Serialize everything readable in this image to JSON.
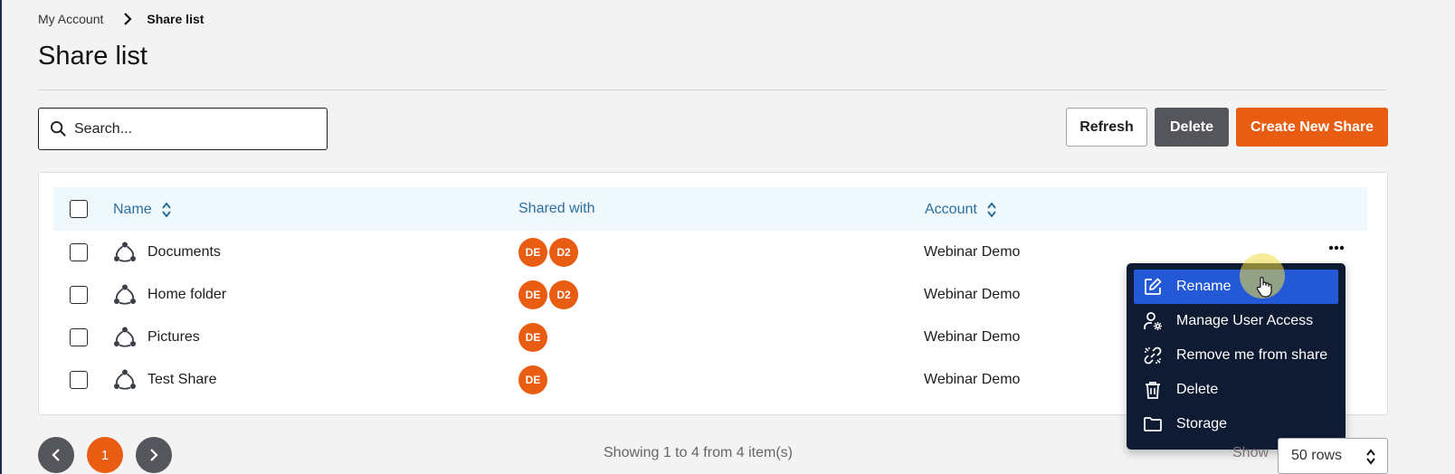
{
  "breadcrumb": {
    "parent": "My Account",
    "current": "Share list"
  },
  "page_title": "Share list",
  "search": {
    "placeholder": "Search...",
    "value": ""
  },
  "toolbar": {
    "refresh_label": "Refresh",
    "delete_label": "Delete",
    "create_label": "Create New Share"
  },
  "table": {
    "columns": {
      "name": "Name",
      "shared_with": "Shared with",
      "account": "Account"
    },
    "rows": [
      {
        "name": "Documents",
        "shared_with": [
          "DE",
          "D2"
        ],
        "account": "Webinar Demo"
      },
      {
        "name": "Home folder",
        "shared_with": [
          "DE",
          "D2"
        ],
        "account": "Webinar Demo"
      },
      {
        "name": "Pictures",
        "shared_with": [
          "DE"
        ],
        "account": "Webinar Demo"
      },
      {
        "name": "Test Share",
        "shared_with": [
          "DE"
        ],
        "account": "Webinar Demo"
      }
    ]
  },
  "context_menu": {
    "items": [
      {
        "label": "Rename",
        "icon": "edit-icon",
        "active": true
      },
      {
        "label": "Manage User Access",
        "icon": "user-gear-icon",
        "active": false
      },
      {
        "label": "Remove me from share",
        "icon": "unlink-icon",
        "active": false
      },
      {
        "label": "Delete",
        "icon": "trash-icon",
        "active": false
      },
      {
        "label": "Storage",
        "icon": "folder-icon",
        "active": false
      }
    ]
  },
  "pagination": {
    "current_page": "1",
    "showing_text": "Showing 1 to 4 from 4 item(s)",
    "show_label": "Show",
    "rows_value": "50 rows"
  },
  "colors": {
    "accent": "#e85d12",
    "menu_bg": "#0e1b33",
    "menu_active": "#2359d6",
    "header_bg": "#eef8fd",
    "link": "#2c6f9e"
  }
}
